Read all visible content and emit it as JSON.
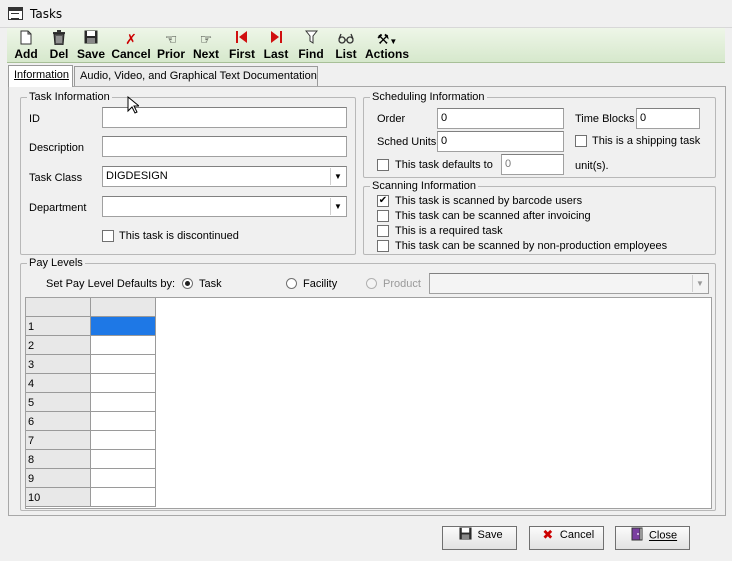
{
  "window": {
    "title": "Tasks"
  },
  "toolbar": {
    "add": "Add",
    "del": "Del",
    "save": "Save",
    "cancel": "Cancel",
    "prior": "Prior",
    "next": "Next",
    "first": "First",
    "last": "Last",
    "find": "Find",
    "list": "List",
    "actions": "Actions"
  },
  "tabs": [
    {
      "label": "Information"
    },
    {
      "label": "Audio, Video, and Graphical Text Documentation"
    }
  ],
  "task_info": {
    "legend": "Task Information",
    "id_label": "ID",
    "id_value": "",
    "description_label": "Description",
    "description_value": "",
    "task_class_label": "Task Class",
    "task_class_value": "DIGDESIGN",
    "department_label": "Department",
    "department_value": "",
    "discontinued_label": "This task is discontinued"
  },
  "scheduling": {
    "legend": "Scheduling Information",
    "order_label": "Order",
    "order_value": "0",
    "time_blocks_label": "Time Blocks",
    "time_blocks_value": "0",
    "sched_units_label": "Sched Units",
    "sched_units_value": "0",
    "shipping_label": "This is a shipping task",
    "defaults_label": "This task defaults to",
    "defaults_value": "0",
    "units_label": "unit(s)."
  },
  "scanning": {
    "legend": "Scanning Information",
    "items": [
      {
        "label": "This task is scanned by barcode users",
        "checked": "✔"
      },
      {
        "label": "This task can be scanned after invoicing",
        "checked": ""
      },
      {
        "label": "This is a required task",
        "checked": ""
      },
      {
        "label": "This task can be scanned by non-production employees",
        "checked": ""
      }
    ]
  },
  "pay_levels": {
    "legend": "Pay Levels",
    "defaults_by_label": "Set Pay Level Defaults by:",
    "options": [
      "Task",
      "Facility",
      "Product"
    ],
    "product_value": "",
    "rows": [
      "1",
      "2",
      "3",
      "4",
      "5",
      "6",
      "7",
      "8",
      "9",
      "10"
    ]
  },
  "footer": {
    "save": "Save",
    "cancel": "Cancel",
    "close": "Close"
  }
}
